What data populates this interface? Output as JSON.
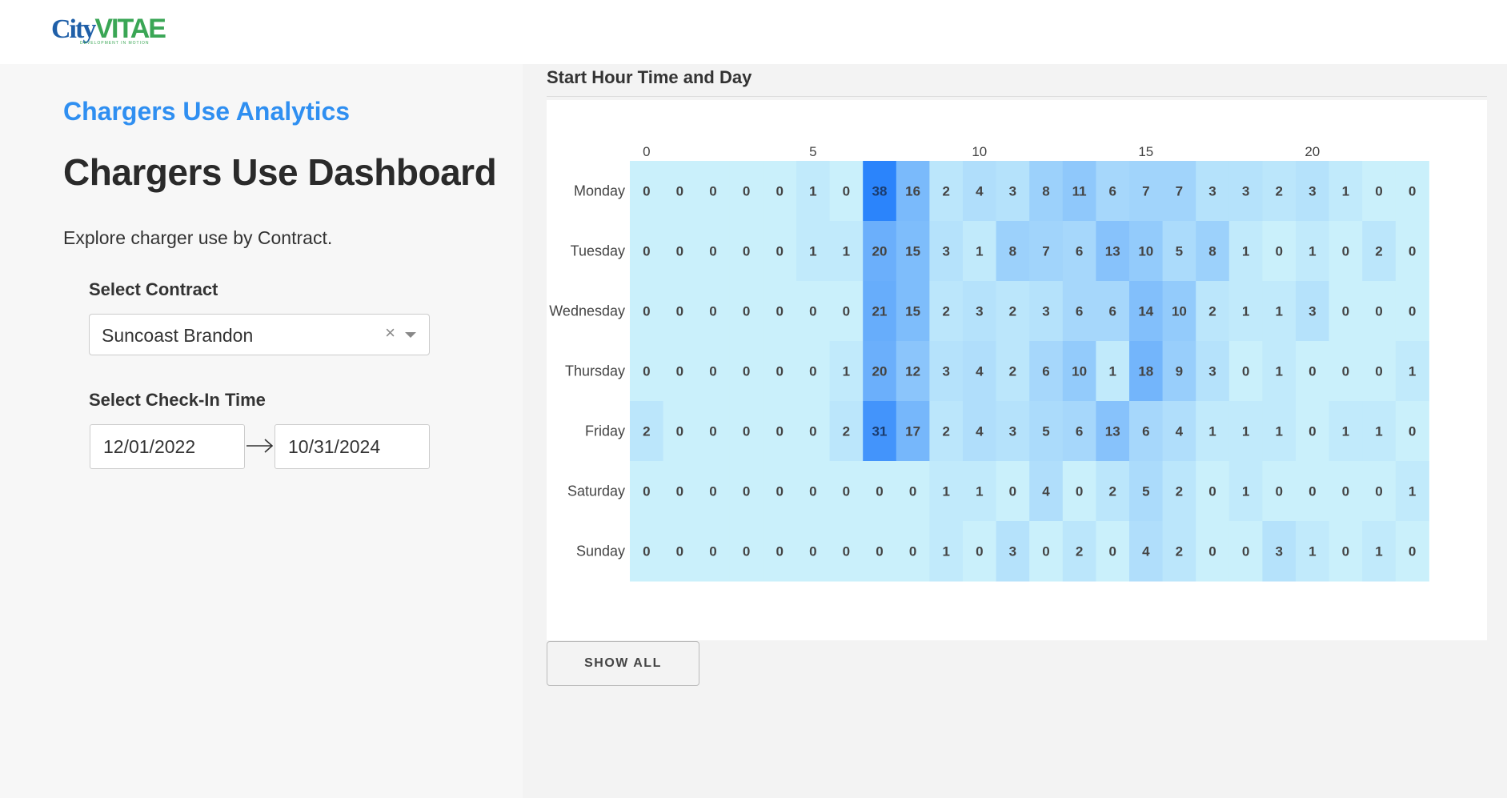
{
  "brand": {
    "logo_text_city": "City",
    "logo_text_vitae": "VITAE",
    "logo_tagline": "DEVELOPMENT IN MOTION"
  },
  "sidebar": {
    "subtitle": "Chargers Use Analytics",
    "title": "Chargers Use Dashboard",
    "description": "Explore charger use by Contract.",
    "contract_label": "Select Contract",
    "contract_value": "Suncoast Brandon",
    "checkin_label": "Select Check-In Time",
    "start_date": "12/01/2022",
    "end_date": "10/31/2024"
  },
  "panel": {
    "title": "Start Hour Time and Day",
    "show_all_label": "SHOW ALL"
  },
  "chart_data": {
    "type": "heatmap",
    "title": "Start Hour Time and Day",
    "x": [
      0,
      1,
      2,
      3,
      4,
      5,
      6,
      7,
      8,
      9,
      10,
      11,
      12,
      13,
      14,
      15,
      16,
      17,
      18,
      19,
      20,
      21,
      22,
      23
    ],
    "x_tick_labels": [
      "0",
      "5",
      "10",
      "15",
      "20"
    ],
    "x_tick_values": [
      0,
      5,
      10,
      15,
      20
    ],
    "y": [
      "Monday",
      "Tuesday",
      "Wednesday",
      "Thursday",
      "Friday",
      "Saturday",
      "Sunday"
    ],
    "z": [
      [
        0,
        0,
        0,
        0,
        0,
        1,
        0,
        38,
        16,
        2,
        4,
        3,
        8,
        11,
        6,
        7,
        7,
        3,
        3,
        2,
        3,
        1,
        0,
        0
      ],
      [
        0,
        0,
        0,
        0,
        0,
        1,
        1,
        20,
        15,
        3,
        1,
        8,
        7,
        6,
        13,
        10,
        5,
        8,
        1,
        0,
        1,
        0,
        2,
        0
      ],
      [
        0,
        0,
        0,
        0,
        0,
        0,
        0,
        21,
        15,
        2,
        3,
        2,
        3,
        6,
        6,
        14,
        10,
        2,
        1,
        1,
        3,
        0,
        0,
        0
      ],
      [
        0,
        0,
        0,
        0,
        0,
        0,
        1,
        20,
        12,
        3,
        4,
        2,
        6,
        10,
        1,
        18,
        9,
        3,
        0,
        1,
        0,
        0,
        0,
        1
      ],
      [
        2,
        0,
        0,
        0,
        0,
        0,
        2,
        31,
        17,
        2,
        4,
        3,
        5,
        6,
        13,
        6,
        4,
        1,
        1,
        1,
        0,
        1,
        1,
        0
      ],
      [
        0,
        0,
        0,
        0,
        0,
        0,
        0,
        0,
        0,
        1,
        1,
        0,
        4,
        0,
        2,
        5,
        2,
        0,
        1,
        0,
        0,
        0,
        0,
        1
      ],
      [
        0,
        0,
        0,
        0,
        0,
        0,
        0,
        0,
        0,
        1,
        0,
        3,
        0,
        2,
        0,
        4,
        2,
        0,
        0,
        3,
        1,
        0,
        1,
        0
      ]
    ],
    "colorscale": [
      "#caf0fb",
      "#2b84fb"
    ],
    "zmin": 0,
    "zmax": 38
  }
}
